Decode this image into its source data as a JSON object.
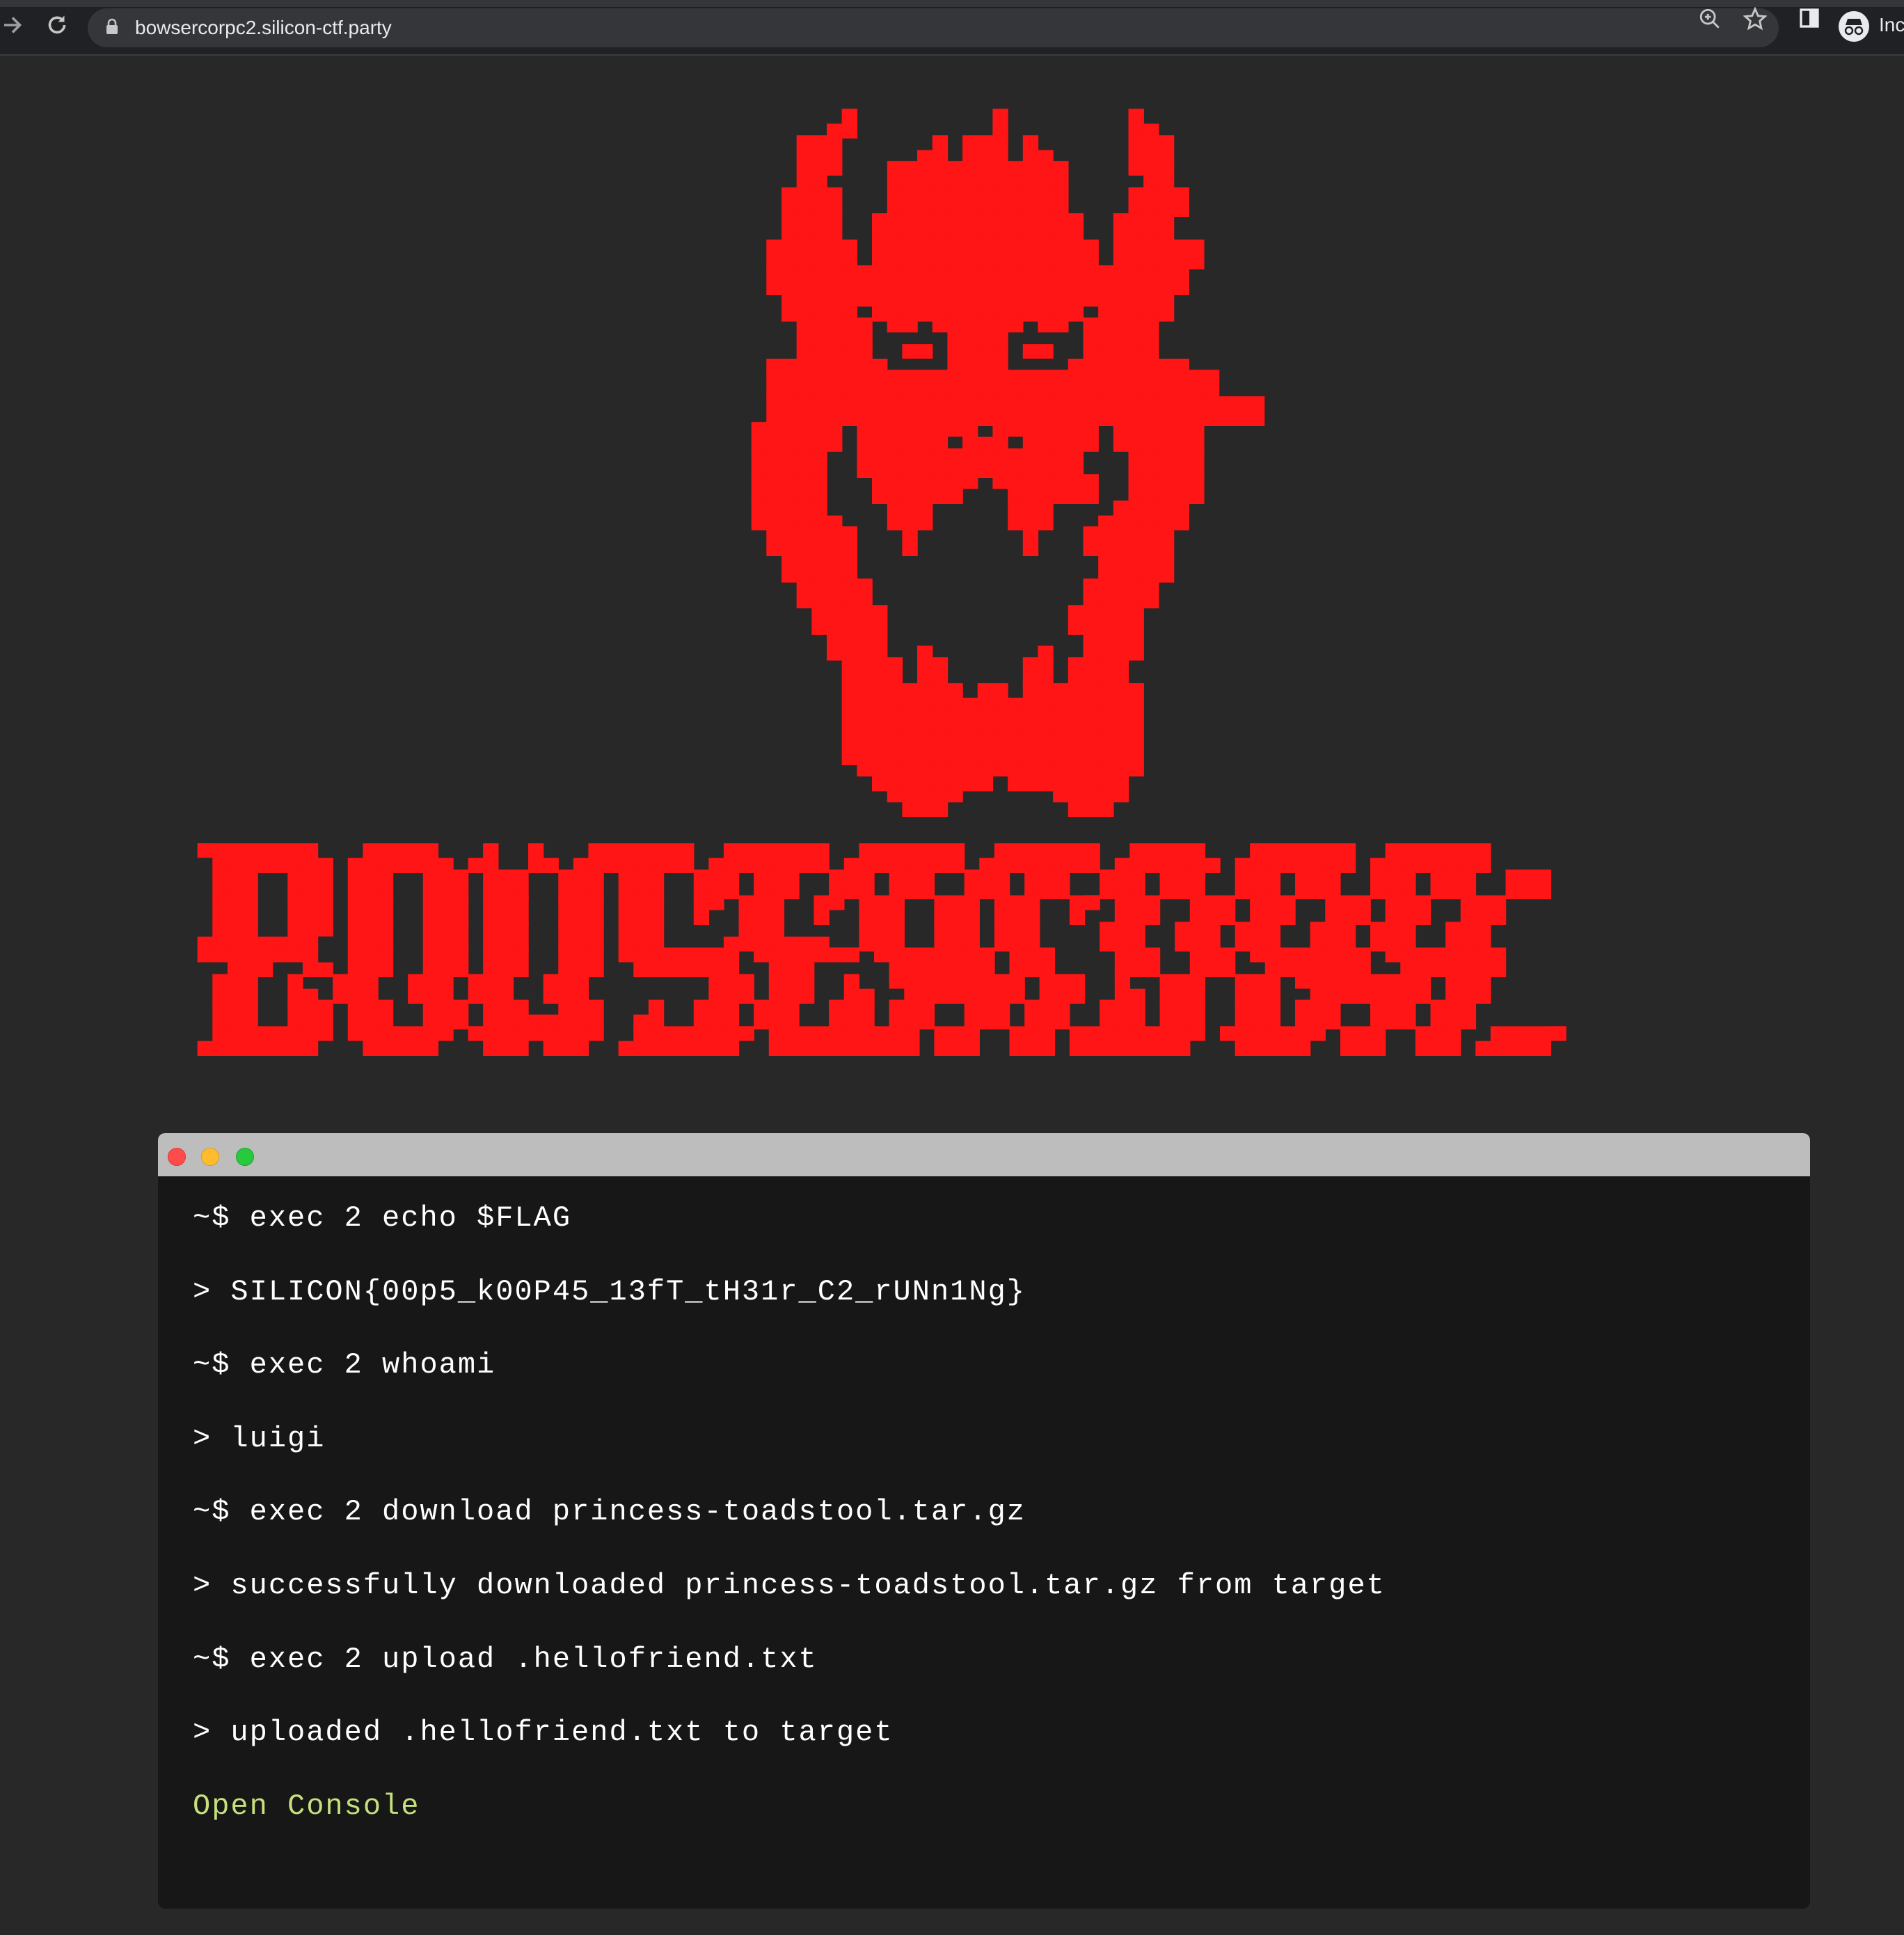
{
  "browser": {
    "url": "bowsercorpc2.silicon-ctf.party",
    "profile_label": "Inc",
    "icons": [
      "forward-arrow-icon",
      "reload-icon",
      "lock-icon",
      "zoom-icon",
      "star-icon",
      "sidepanel-icon",
      "incognito-icon"
    ]
  },
  "ascii_logo": "     ▄█         █        █▄\n   ███     ▄█ ███ █▄     ███\n   ██▀   ████████████    ▀██\n  ████   ████████████    ████\n  ████  ██████████████  ████\n ██████ ███████████████ ██████\n ████████████████████████████\n  █████▀██████████████▀█████\n   █████ ▀▀ ▀████▀ ▀▀ █████\n ▄▄█████▄ ▀▀ ████ ▀▀ ▄█████▄▄\n ██████████████████████████████\n █████████████████████████████████\n██████ ██████▀█▄█▀█████ ██████\n█████  ███████████████   █████\n█████   ██████▀ ▀██████  █████\n█████▄   ███     ███   ▄█████\n ██████   █       █   ██████\n  █████                █████\n   █████              █████\n    █████            █████\n     ████  ▄       ▄  ████\n      ████ ██     ██ ████\n      ████████▄██▄████████\n      ████████████████████\n      ████████████████████\n       ▀████████▀████████▀\n         ▀███▀      ▀███▀",
  "ascii_title": "▀███████▄ ▄█████▄ ▄█  █▄ ▄███████ ▄███████ ▄███████ ▄███████ ▄█████▄ ▄███████ ▄███████\n ███  ███ ███  ███ ███  ███ ███  ███ ███  ███ ███  ███ ███  ███ ███  ███ ███  ███ ███  ███\n ███  ███ ███  ███ ███  ███ ███  █▀ ███  █▀ ███  ███ ███  █▀ ███  ███ ███  ███ ███  ███\n▄███▄▄██▀ ███  ███ ███  ███ ███    ▄███▄▄▄  ███  ███ ███    ███  ███ ███  ███ ███  ███\n▀▀███▀▀█▄ ███  ███ ███  ███ ▀███████ ▀███▀▀▀ ▀███████ ███    ███  ███ ▀███████ ▀███████\n ███  █▄ ███  ███ ███  ███        ███ ███  █▄ ▀████████ ███  █▄ ███  ███ ▀████████ ███\n ███  ███ ███  ███ ███▄▄███  ▄█  ███ ███  ███ ███  ███ ███  ███ ███  ███ ███  ███ ███\n▄███████▀ ▀█████▀ ▀███▀███▀ ▄███████▀ ██████████ ███  ███ ████████▀ ▀█████▀ ███  ███ ▄████▀",
  "terminal": {
    "window_dots": [
      "#ff4b4b",
      "#ffbd2e",
      "#27c93f"
    ],
    "lines": [
      "~$ exec 2 echo $FLAG",
      "> SILICON{00p5_k00P45_13fT_tH31r_C2_rUNn1Ng}",
      "~$ exec 2 whoami",
      "> luigi",
      "~$ exec 2 download princess-toadstool.tar.gz",
      "> successfully downloaded princess-toadstool.tar.gz from target",
      "~$ exec 2 upload .hellofriend.txt",
      "> uploaded .hellofriend.txt to target"
    ],
    "open_console_label": "Open Console"
  },
  "colors": {
    "accent_red": "#ff1515",
    "console_link": "#c6e07d",
    "background": "#282828",
    "terminal_bg": "#171717"
  }
}
